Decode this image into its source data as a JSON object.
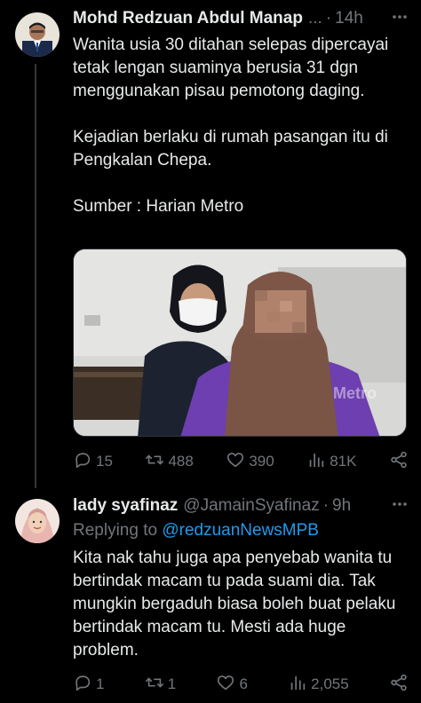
{
  "tweets": [
    {
      "author_name": "Mohd Redzuan Abdul Manap",
      "author_handle": "...",
      "separator": "·",
      "time": "14h",
      "paragraphs": [
        "Wanita usia 30 ditahan selepas dipercayai tetak lengan suaminya berusia 31 dgn menggunakan  pisau pemotong daging.",
        "Kejadian berlaku di rumah pasangan itu di Pengkalan Chepa.",
        "Sumber : Harian Metro"
      ],
      "media_watermark": "Metro",
      "stats": {
        "replies": "15",
        "reposts": "488",
        "likes": "390",
        "views": "81K"
      }
    },
    {
      "author_name": "lady syafinaz",
      "author_handle": "@JamainSyafinaz",
      "separator": "·",
      "time": "9h",
      "replying_prefix": "Replying to",
      "replying_to": "@redzuanNewsMPB",
      "paragraphs": [
        "Kita nak tahu juga apa penyebab wanita tu bertindak macam tu pada suami dia. Tak mungkin bergaduh biasa boleh buat pelaku bertindak macam tu. Mesti ada huge problem."
      ],
      "stats": {
        "replies": "1",
        "reposts": "1",
        "likes": "6",
        "views": "2,055"
      }
    }
  ],
  "colors": {
    "background": "#000000",
    "text": "#e7e9ea",
    "muted": "#71767b",
    "link": "#1d9bf0",
    "border": "#2f3336"
  },
  "icons": [
    "reply-icon",
    "repost-icon",
    "like-icon",
    "views-icon",
    "share-icon",
    "more-icon"
  ]
}
